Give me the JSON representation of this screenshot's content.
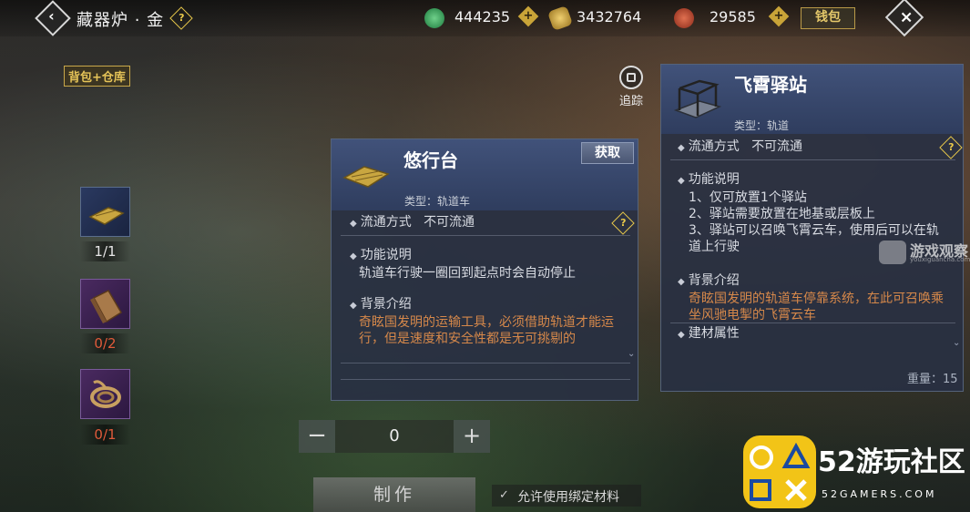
{
  "header": {
    "title": "藏器炉 · 金",
    "currencies": [
      {
        "icon": "jade-coin-icon",
        "value": "444235"
      },
      {
        "icon": "gold-ingot-icon",
        "value": "3432764"
      },
      {
        "icon": "red-token-icon",
        "value": "29585"
      }
    ],
    "wallet_label": "钱包"
  },
  "sidebar": {
    "bag_label": "背包+仓库",
    "materials": [
      {
        "icon": "golden-board-icon",
        "count": "1/1"
      },
      {
        "icon": "wood-plank-icon",
        "count": "0/2"
      },
      {
        "icon": "rope-coil-icon",
        "count": "0/1"
      }
    ]
  },
  "track": {
    "label": "追踪"
  },
  "item_panel": {
    "name": "悠行台",
    "type": "类型：轨道车",
    "get_label": "获取",
    "circulation": "流通方式",
    "circulation_value": "不可流通",
    "function_title": "功能说明",
    "function_text": "轨道车行驶一圈回到起点时会自动停止",
    "lore_title": "背景介绍",
    "lore_text": "奇眩国发明的运输工具，必须借助轨道才能运行，但是速度和安全性都是无可挑剔的"
  },
  "target_panel": {
    "name": "飞霄驿站",
    "type": "类型：轨道",
    "circulation": "流通方式",
    "circulation_value": "不可流通",
    "function_title": "功能说明",
    "function_lines": [
      "1、仅可放置1个驿站",
      "2、驿站需要放置在地基或层板上",
      "3、驿站可以召唤飞霄云车，使用后可以在轨道上行驶"
    ],
    "lore_title": "背景介绍",
    "lore_text": "奇眩国发明的轨道车停靠系统，在此可召唤乘坐风驰电掣的飞霄云车",
    "material_title": "建材属性",
    "weight": "重量：15"
  },
  "craft": {
    "minus": "−",
    "quantity": "0",
    "plus": "+",
    "make_label": "制作",
    "bind_option": "允许使用绑定材料"
  },
  "watermarks": {
    "wm1_title": "游戏观察",
    "wm1_sub": "youxiguancha.com",
    "wm2_title": "52游玩社区",
    "wm2_sub": "52GAMERS.COM"
  },
  "colors": {
    "gold": "#e6c458",
    "lore": "#d6884a",
    "lack": "#e05a3a",
    "panel": "#2f3d5e"
  }
}
